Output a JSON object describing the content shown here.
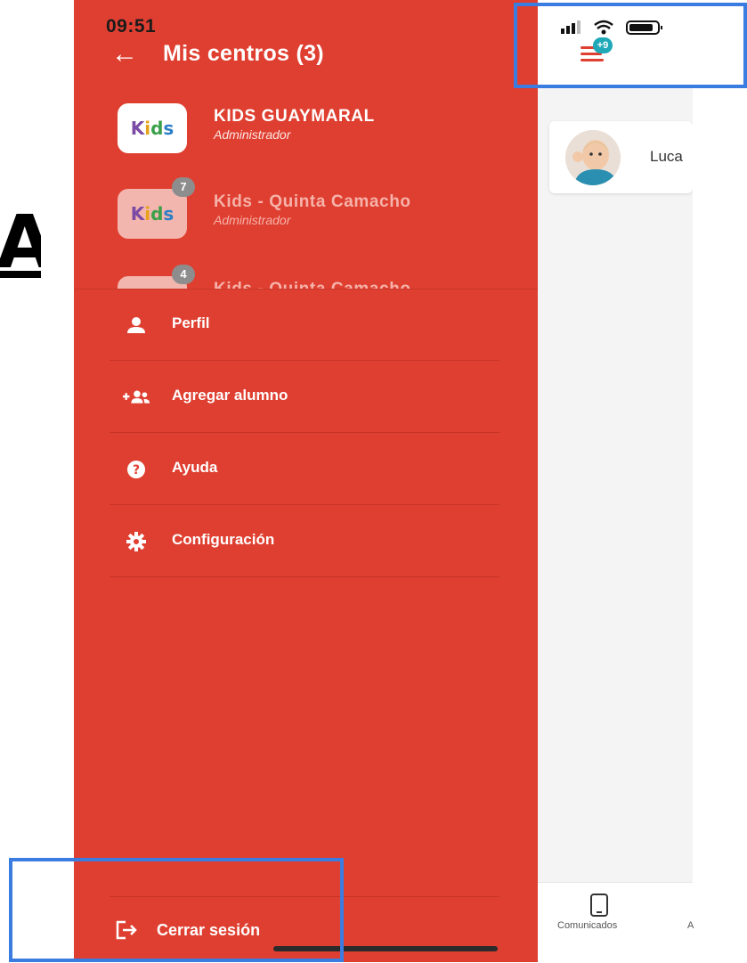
{
  "left_margin": {
    "glyph": "A"
  },
  "status_bar": {
    "time": "09:51"
  },
  "drawer": {
    "back_icon": "←",
    "title": "Mis centros (3)",
    "centers": [
      {
        "name": "KIDS GUAYMARAL",
        "role": "Administrador",
        "logo": "Kids",
        "badge": ""
      },
      {
        "name": "Kids - Quinta Camacho",
        "role": "Administrador",
        "logo": "Kids",
        "badge": "7"
      },
      {
        "name": "Kids - Quinta Camacho",
        "role": "",
        "logo": "Kids",
        "badge": "4"
      }
    ],
    "menu": [
      {
        "label": "Perfil",
        "icon": "person-icon"
      },
      {
        "label": "Agregar alumno",
        "icon": "add-users-icon"
      },
      {
        "label": "Ayuda",
        "icon": "help-icon"
      },
      {
        "label": "Configuración",
        "icon": "gear-icon"
      }
    ],
    "logout_label": "Cerrar sesión"
  },
  "underlay": {
    "notification_badge": "+9",
    "student_name": "Luca",
    "tabs": [
      {
        "label": "Comunicados",
        "icon": "tablet-icon"
      },
      {
        "label": "A"
      }
    ]
  },
  "colors": {
    "drawer_red": "#df3f30",
    "highlight_blue": "#3b7ce0",
    "badge_teal": "#1fa8b8"
  }
}
